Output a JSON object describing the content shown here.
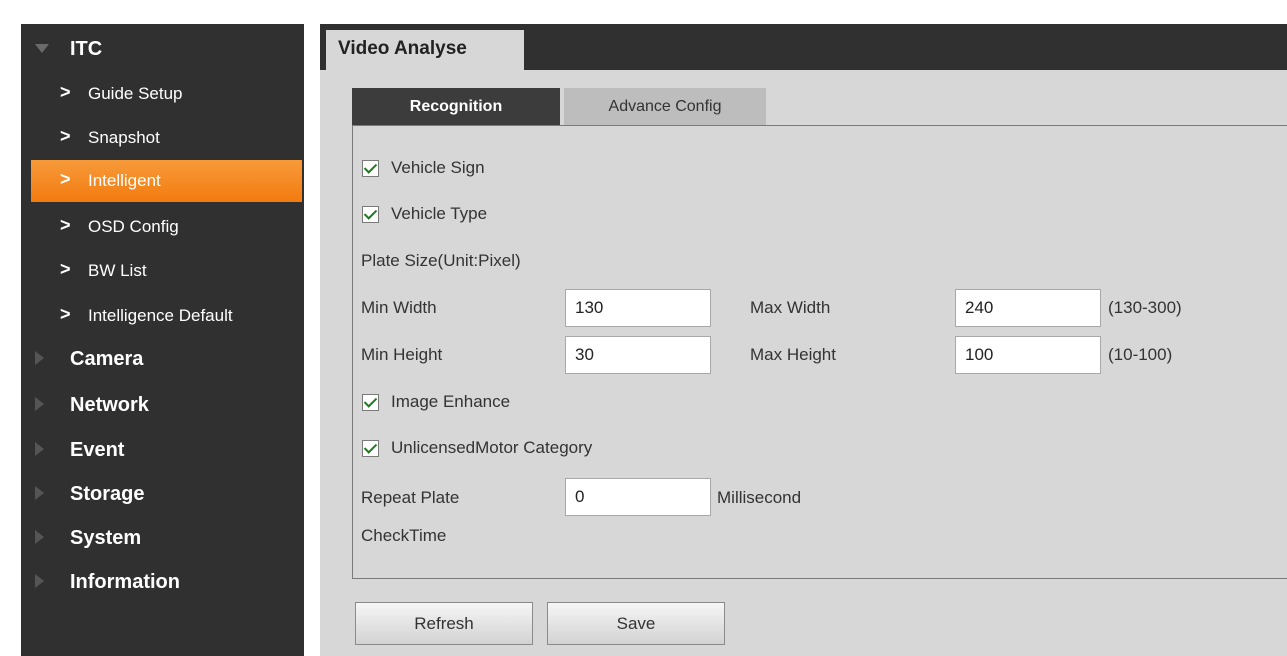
{
  "sidebar": {
    "sections": [
      {
        "label": "ITC",
        "expanded": true
      },
      {
        "label": "Camera",
        "expanded": false
      },
      {
        "label": "Network",
        "expanded": false
      },
      {
        "label": "Event",
        "expanded": false
      },
      {
        "label": "Storage",
        "expanded": false
      },
      {
        "label": "System",
        "expanded": false
      },
      {
        "label": "Information",
        "expanded": false
      }
    ],
    "itc_items": [
      {
        "label": "Guide Setup"
      },
      {
        "label": "Snapshot"
      },
      {
        "label": "Intelligent",
        "active": true
      },
      {
        "label": "OSD Config"
      },
      {
        "label": "BW List"
      },
      {
        "label": "Intelligence Default"
      }
    ],
    "chevron": ">"
  },
  "main": {
    "tab_title": "Video Analyse",
    "subtabs": [
      "Recognition",
      "Advance Config"
    ],
    "vehicle_sign": {
      "label": "Vehicle Sign",
      "checked": true
    },
    "vehicle_type": {
      "label": "Vehicle Type",
      "checked": true
    },
    "plate_size_label": "Plate Size(Unit:Pixel)",
    "min_width": {
      "label": "Min Width",
      "value": "130"
    },
    "max_width": {
      "label": "Max Width",
      "value": "240",
      "range": "(130-300)"
    },
    "min_height": {
      "label": "Min Height",
      "value": "30"
    },
    "max_height": {
      "label": "Max Height",
      "value": "100",
      "range": "(10-100)"
    },
    "image_enhance": {
      "label": "Image Enhance",
      "checked": true
    },
    "unlicensed": {
      "label": "UnlicensedMotor Category",
      "checked": true
    },
    "repeat_plate": {
      "label_line1": "Repeat Plate",
      "label_line2": "CheckTime",
      "value": "0",
      "unit": "Millisecond"
    },
    "buttons": {
      "refresh": "Refresh",
      "save": "Save"
    }
  },
  "colors": {
    "active_item": "#f48a22",
    "sidebar_bg": "#303030",
    "panel_bg": "#d7d7d7",
    "check": "#1f7a1f"
  }
}
